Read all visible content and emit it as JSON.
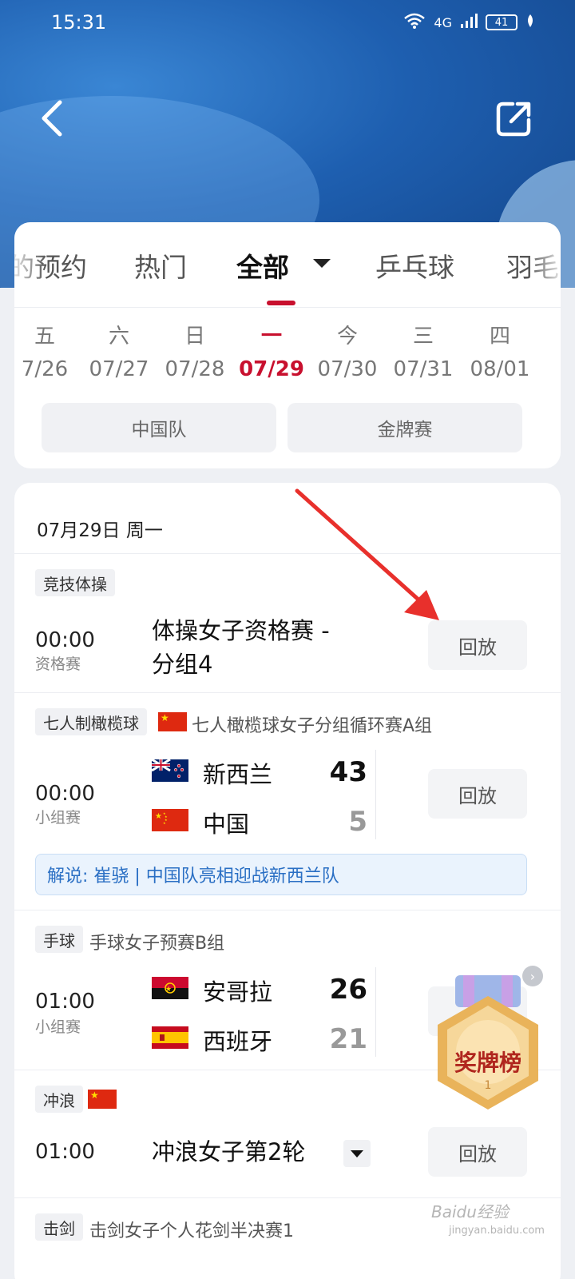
{
  "status_bar": {
    "time": "15:31",
    "network": "4G",
    "battery": "41"
  },
  "tabs": [
    {
      "label": "的预约"
    },
    {
      "label": "热门"
    },
    {
      "label": "全部"
    },
    {
      "label": "乒乓球"
    },
    {
      "label": "羽毛"
    }
  ],
  "days": [
    {
      "dow": "五",
      "date": "7/26"
    },
    {
      "dow": "六",
      "date": "07/27"
    },
    {
      "dow": "日",
      "date": "07/28"
    },
    {
      "dow": "一",
      "date": "07/29"
    },
    {
      "dow": "今",
      "date": "07/30"
    },
    {
      "dow": "三",
      "date": "07/31"
    },
    {
      "dow": "四",
      "date": "08/01"
    }
  ],
  "filters": {
    "china_team": "中国队",
    "gold_medal": "金牌赛"
  },
  "schedule": {
    "date_header": "07月29日 周一",
    "matches": [
      {
        "tag": "竞技体操",
        "time": "00:00",
        "stage": "资格赛",
        "title_line1": "体操女子资格赛 -",
        "title_line2": "分组4",
        "action": "回放"
      },
      {
        "tag": "七人制橄榄球",
        "subtitle": "七人橄榄球女子分组循环赛A组",
        "time": "00:00",
        "stage": "小组赛",
        "team1": "新西兰",
        "score1": "43",
        "team2": "中国",
        "score2": "5",
        "action": "回放",
        "commentary": "解说: 崔骁 | 中国队亮相迎战新西兰队"
      },
      {
        "tag": "手球",
        "subtitle": "手球女子预赛B组",
        "time": "01:00",
        "stage": "小组赛",
        "team1": "安哥拉",
        "score1": "26",
        "team2": "西班牙",
        "score2": "21"
      },
      {
        "tag": "冲浪",
        "time": "01:00",
        "title": "冲浪女子第2轮",
        "action": "回放"
      },
      {
        "tag": "击剑",
        "subtitle": "击剑女子个人花剑半决赛1"
      }
    ]
  },
  "medal_widget": {
    "label": "奖牌榜",
    "rank": "1"
  },
  "watermark": {
    "main": "Baidu经验",
    "sub": "jingyan.baidu.com"
  },
  "colors": {
    "accent": "#c8102e",
    "hero_blue": "#1e5fb0",
    "commentary_blue": "#2a6fc4"
  }
}
